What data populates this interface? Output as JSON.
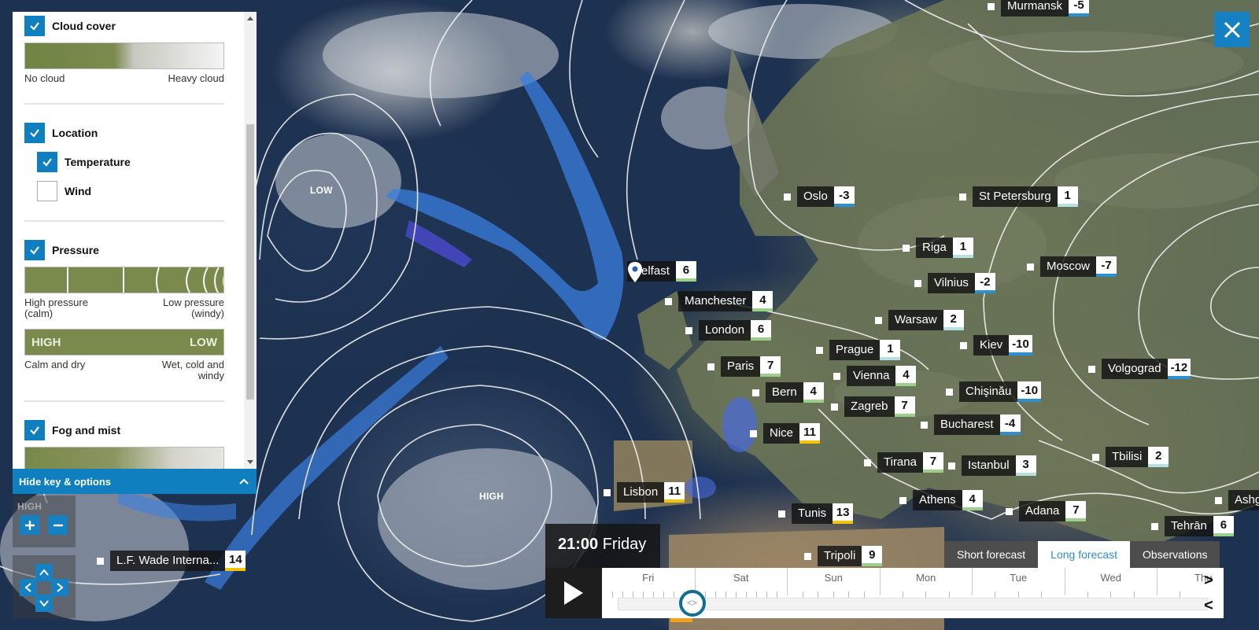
{
  "key": {
    "sections": [
      {
        "label": "Cloud cover",
        "checked": true,
        "legend_left": "No cloud",
        "legend_right": "Heavy cloud"
      },
      {
        "label": "Location",
        "checked": true,
        "sub": [
          {
            "label": "Temperature",
            "checked": true
          },
          {
            "label": "Wind",
            "checked": false
          }
        ]
      },
      {
        "label": "Pressure",
        "checked": true,
        "legend_left": "High pressure (calm)",
        "legend_right": "Low pressure (windy)",
        "bar2_left": "HIGH",
        "bar2_right": "LOW",
        "legend2_left": "Calm and dry",
        "legend2_right": "Wet, cold and windy"
      },
      {
        "label": "Fog and mist",
        "checked": true
      }
    ],
    "hide_button": "Hide key & options",
    "hide_caret": "^"
  },
  "map": {
    "pressure_labels": [
      {
        "text": "LOW",
        "name": "low-pressure-label"
      },
      {
        "text": "HIGH",
        "name": "high-pressure-label-atlantic"
      },
      {
        "text": "HIGH",
        "name": "high-pressure-label-controls"
      }
    ],
    "cities": [
      {
        "name": "Murmansk",
        "temp": "-5",
        "band": "cold"
      },
      {
        "name": "Oslo",
        "temp": "-3",
        "band": "cold"
      },
      {
        "name": "St Petersburg",
        "temp": "1",
        "band": "cool"
      },
      {
        "name": "Riga",
        "temp": "1",
        "band": "cool"
      },
      {
        "name": "Moscow",
        "temp": "-7",
        "band": "cold"
      },
      {
        "name": "Belfast",
        "temp": "6",
        "band": "mild",
        "pin": true
      },
      {
        "name": "Vilnius",
        "temp": "-2",
        "band": "cold"
      },
      {
        "name": "Manchester",
        "temp": "4",
        "band": "mild"
      },
      {
        "name": "Warsaw",
        "temp": "2",
        "band": "cool"
      },
      {
        "name": "London",
        "temp": "6",
        "band": "mild"
      },
      {
        "name": "Prague",
        "temp": "1",
        "band": "cool"
      },
      {
        "name": "Kiev",
        "temp": "-10",
        "band": "cold"
      },
      {
        "name": "Paris",
        "temp": "7",
        "band": "mild"
      },
      {
        "name": "Vienna",
        "temp": "4",
        "band": "mild"
      },
      {
        "name": "Volgograd",
        "temp": "-12",
        "band": "cold"
      },
      {
        "name": "Bern",
        "temp": "4",
        "band": "mild"
      },
      {
        "name": "Chişinău",
        "temp": "-10",
        "band": "cold"
      },
      {
        "name": "Zagreb",
        "temp": "7",
        "band": "mild"
      },
      {
        "name": "Bucharest",
        "temp": "-4",
        "band": "cold"
      },
      {
        "name": "Nice",
        "temp": "11",
        "band": "warm"
      },
      {
        "name": "Tbilisi",
        "temp": "2",
        "band": "cool"
      },
      {
        "name": "Tirana",
        "temp": "7",
        "band": "mild"
      },
      {
        "name": "Istanbul",
        "temp": "3",
        "band": "cool"
      },
      {
        "name": "Lisbon",
        "temp": "11",
        "band": "warm"
      },
      {
        "name": "Athens",
        "temp": "4",
        "band": "mild"
      },
      {
        "name": "Ashg",
        "temp": "",
        "band": "cool"
      },
      {
        "name": "Tunis",
        "temp": "13",
        "band": "warm"
      },
      {
        "name": "Adana",
        "temp": "7",
        "band": "mild"
      },
      {
        "name": "Tehrān",
        "temp": "6",
        "band": "mild"
      },
      {
        "name": "Tripoli",
        "temp": "9",
        "band": "mild"
      },
      {
        "name": "L.F. Wade Interna...",
        "temp": "14",
        "band": "warm"
      }
    ],
    "band_colors": {
      "cold": "#2b8fd0",
      "cool": "#b7e0e0",
      "mild": "#9ccf8a",
      "warm": "#f2c20f"
    }
  },
  "controls": {
    "zoom_in": "+",
    "zoom_out": "−",
    "pan_up": "^",
    "pan_left": "<",
    "pan_right": ">",
    "pan_down": "v",
    "close": "×"
  },
  "timeline": {
    "time": "21:00",
    "day": "Friday",
    "days": [
      "Fri",
      "Sat",
      "Sun",
      "Mon",
      "Tue",
      "Wed",
      "Thu"
    ],
    "position_fraction": 0.126,
    "handle_glyph": "<>",
    "next": ">",
    "prev": "<",
    "tabs": [
      {
        "label": "Short forecast",
        "active": false
      },
      {
        "label": "Long forecast",
        "active": true
      },
      {
        "label": "Observations",
        "active": false
      }
    ]
  }
}
